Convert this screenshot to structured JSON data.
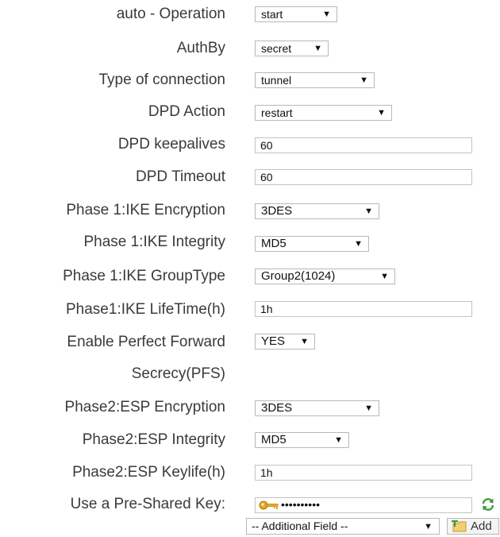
{
  "fields": {
    "auto_operation": {
      "label": "auto - Operation",
      "value": "start"
    },
    "authby": {
      "label": "AuthBy",
      "value": "secret"
    },
    "conn_type": {
      "label": "Type of connection",
      "value": "tunnel"
    },
    "dpd_action": {
      "label": "DPD Action",
      "value": "restart"
    },
    "dpd_keepalives": {
      "label": "DPD keepalives",
      "value": "60"
    },
    "dpd_timeout": {
      "label": "DPD Timeout",
      "value": "60"
    },
    "p1_encryption": {
      "label": "Phase 1:IKE Encryption",
      "value": "3DES"
    },
    "p1_integrity": {
      "label": "Phase 1:IKE Integrity",
      "value": "MD5"
    },
    "p1_group": {
      "label": "Phase 1:IKE GroupType",
      "value": "Group2(1024)"
    },
    "p1_lifetime": {
      "label": "Phase1:IKE LifeTime(h)",
      "value": "1h"
    },
    "pfs": {
      "label_line1": "Enable Perfect Forward",
      "label_line2": "Secrecy(PFS)",
      "value": "YES"
    },
    "p2_encryption": {
      "label": "Phase2:ESP Encryption",
      "value": "3DES"
    },
    "p2_integrity": {
      "label": "Phase2:ESP Integrity",
      "value": "MD5"
    },
    "p2_keylife": {
      "label": "Phase2:ESP Keylife(h)",
      "value": "1h"
    },
    "psk": {
      "label": "Use a Pre-Shared Key:",
      "value": "••••••••••",
      "icon": "key-icon",
      "refresh_icon": "refresh-icon"
    }
  },
  "additional": {
    "select_value": "-- Additional Field --",
    "add_label": "Add",
    "add_icon": "add-field-icon"
  },
  "dropdown_arrow": "▼",
  "colors": {
    "border": "#b8b8b8",
    "label": "#3a3a3a",
    "key": "#e0a020",
    "refresh": "#3a9a3a"
  }
}
